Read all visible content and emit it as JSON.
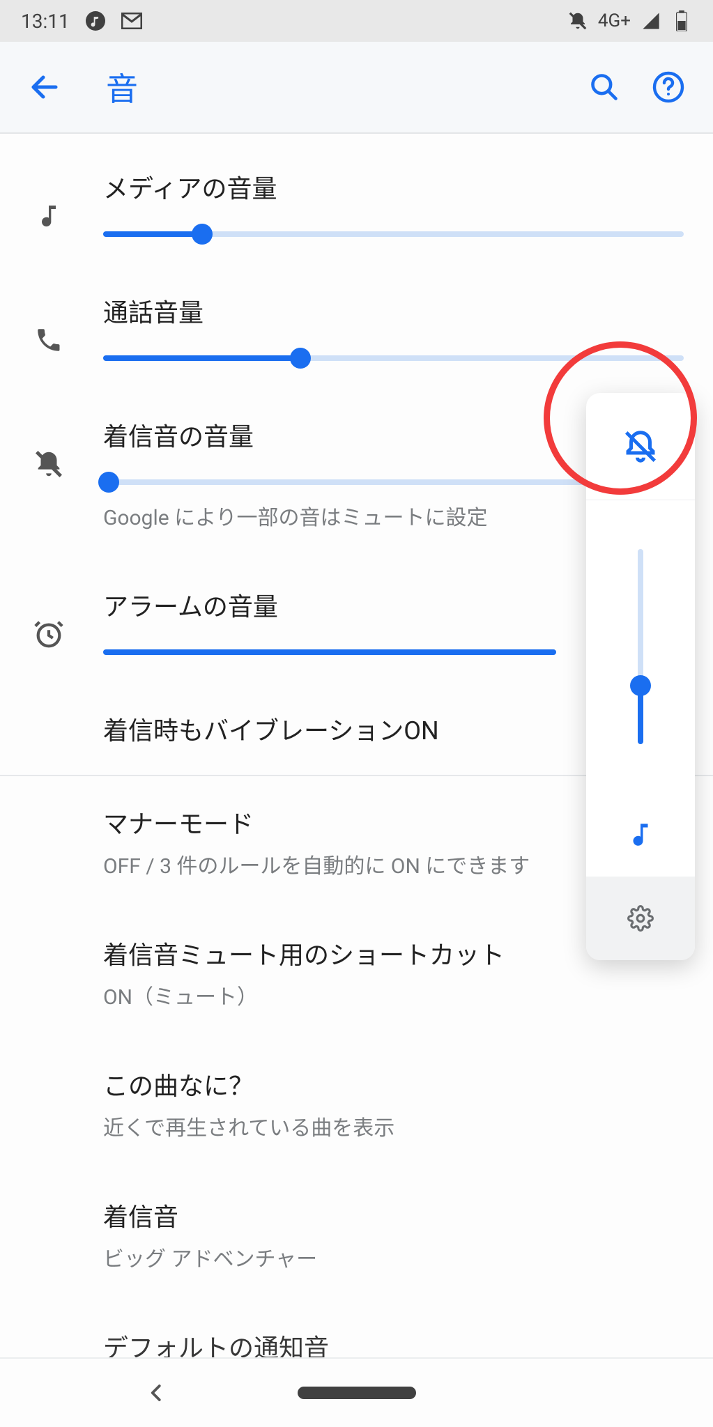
{
  "status": {
    "time": "13:11",
    "network": "4G+"
  },
  "header": {
    "title": "音"
  },
  "sliders": {
    "media": {
      "label": "メディアの音量",
      "value": 17
    },
    "call": {
      "label": "通話音量",
      "value": 34
    },
    "ring": {
      "label": "着信音の音量",
      "value": 0,
      "subtitle": "Google により一部の音はミュートに設定"
    },
    "alarm": {
      "label": "アラームの音量",
      "value": 100
    }
  },
  "options": {
    "vibrate": {
      "title": "着信時もバイブレーションON"
    },
    "dnd": {
      "title": "マナーモード",
      "subtitle": "OFF / 3 件のルールを自動的に ON にできます"
    },
    "shortcut": {
      "title": "着信音ミュート用のショートカット",
      "subtitle": "ON（ミュート）"
    },
    "now_playing": {
      "title": "この曲なに？",
      "subtitle": "近くで再生されている曲を表示"
    },
    "ringtone": {
      "title": "着信音",
      "subtitle": "ビッグ アドベンチャー"
    },
    "default_notification": {
      "title": "デフォルトの通知音"
    }
  },
  "volume_panel": {
    "level": 30
  },
  "colors": {
    "accent": "#1a6ef0",
    "annotation": "#f23b3b"
  }
}
